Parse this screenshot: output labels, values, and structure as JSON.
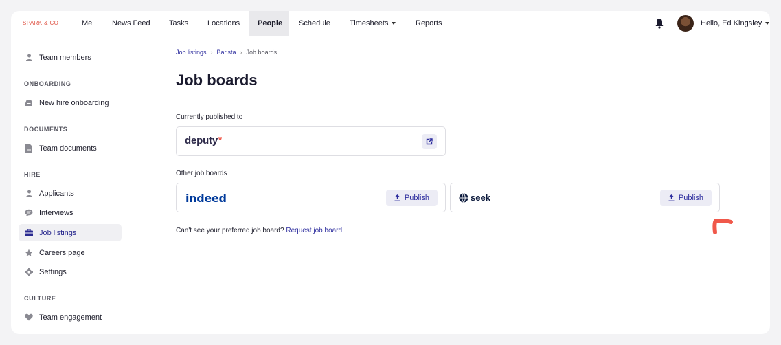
{
  "brand": "SPARK & CO",
  "nav": {
    "items": [
      "Me",
      "News Feed",
      "Tasks",
      "Locations",
      "People",
      "Schedule",
      "Timesheets",
      "Reports"
    ],
    "active": "People",
    "greeting": "Hello, Ed Kingsley"
  },
  "sidebar": {
    "team_members": "Team members",
    "onboarding_head": "ONBOARDING",
    "new_hire": "New hire onboarding",
    "documents_head": "DOCUMENTS",
    "team_documents": "Team documents",
    "hire_head": "HIRE",
    "applicants": "Applicants",
    "interviews": "Interviews",
    "job_listings": "Job listings",
    "careers_page": "Careers page",
    "settings": "Settings",
    "culture_head": "CULTURE",
    "team_engagement": "Team engagement"
  },
  "breadcrumb": [
    "Job listings",
    "Barista",
    "Job boards"
  ],
  "page_title": "Job boards",
  "published_label": "Currently published to",
  "published_board": "deputy",
  "other_label": "Other job boards",
  "other_boards": [
    {
      "name": "indeed",
      "action": "Publish"
    },
    {
      "name": "seek",
      "action": "Publish"
    }
  ],
  "footnote": {
    "text": "Can't see your preferred job board?",
    "link": "Request job board"
  },
  "colors": {
    "brand": "#e0584a",
    "link": "#2d2d9e",
    "annotation": "#f0584a"
  }
}
